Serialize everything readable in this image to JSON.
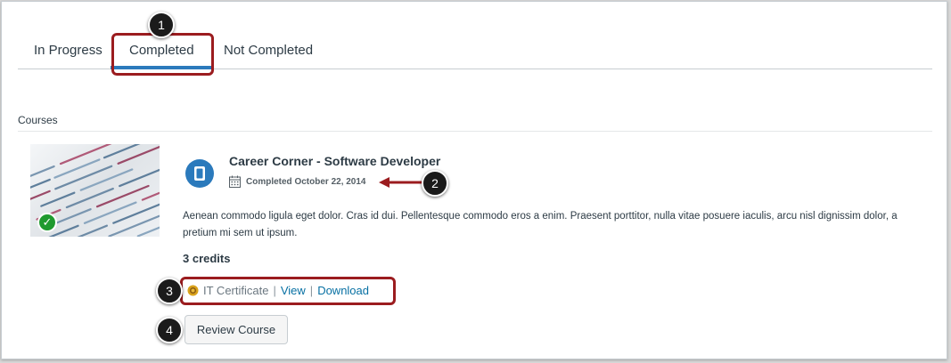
{
  "tabs": [
    {
      "label": "In Progress",
      "active": false
    },
    {
      "label": "Completed",
      "active": true
    },
    {
      "label": "Not Completed",
      "active": false
    }
  ],
  "callouts": [
    "1",
    "2",
    "3",
    "4"
  ],
  "section": {
    "label": "Courses"
  },
  "course": {
    "title": "Career Corner - Software Developer",
    "completed_text": "Completed October 22, 2014",
    "description": "Aenean commodo ligula eget dolor. Cras id dui. Pellentesque commodo eros a enim. Praesent porttitor, nulla vitae posuere iaculis, arcu nisl dignissim dolor, a pretium mi sem ut ipsum.",
    "credits": "3 credits",
    "certificate": {
      "name": "IT Certificate",
      "separator": "|",
      "view_label": "View",
      "download_label": "Download"
    },
    "review_label": "Review Course"
  },
  "colors": {
    "accent": "#2b7abc",
    "highlight": "#9b1c1f",
    "link": "#0770a3",
    "success": "#1f9a2f"
  }
}
